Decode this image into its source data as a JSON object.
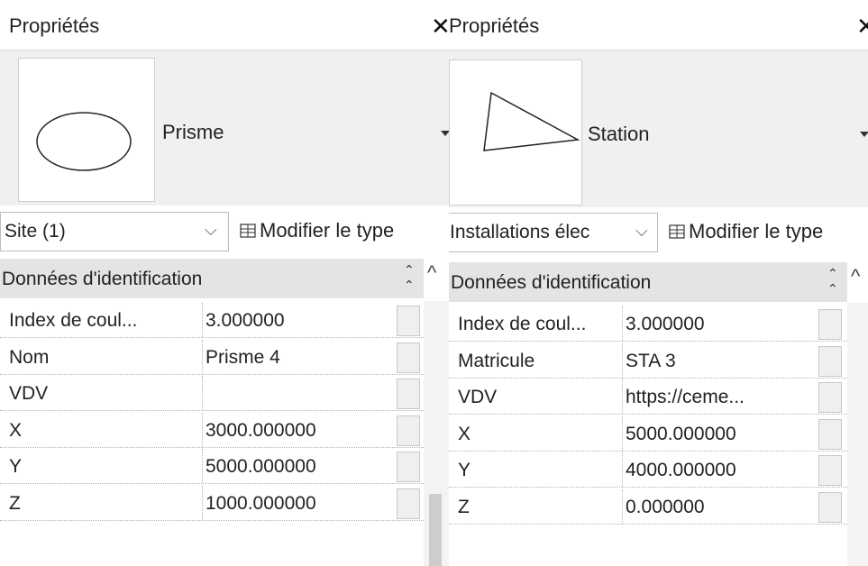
{
  "left_panel": {
    "title": "Propriétés",
    "close_symbol": "✕",
    "type_name": "Prisme",
    "preview_icon": "ellipse-icon",
    "selector_label": "Site (1)",
    "edit_type_label": "Modifier le type",
    "section_label": "Données d'identification",
    "rows": [
      {
        "name": "Index de coul...",
        "value": "3.000000"
      },
      {
        "name": "Nom",
        "value": "Prisme 4"
      },
      {
        "name": "VDV",
        "value": ""
      },
      {
        "name": "X",
        "value": "3000.000000"
      },
      {
        "name": "Y",
        "value": "5000.000000"
      },
      {
        "name": "Z",
        "value": "1000.000000"
      }
    ]
  },
  "right_panel": {
    "title": "Propriétés",
    "close_symbol": "✕",
    "type_name": "Station",
    "preview_icon": "triangle-icon",
    "selector_label": "Installations élec",
    "edit_type_label": "Modifier le type",
    "section_label": "Données d'identification",
    "rows": [
      {
        "name": "Index de coul...",
        "value": "3.000000"
      },
      {
        "name": "Matricule",
        "value": "STA 3"
      },
      {
        "name": "VDV",
        "value": "https://ceme..."
      },
      {
        "name": "X",
        "value": "5000.000000"
      },
      {
        "name": "Y",
        "value": "4000.000000"
      },
      {
        "name": "Z",
        "value": "0.000000"
      }
    ]
  }
}
